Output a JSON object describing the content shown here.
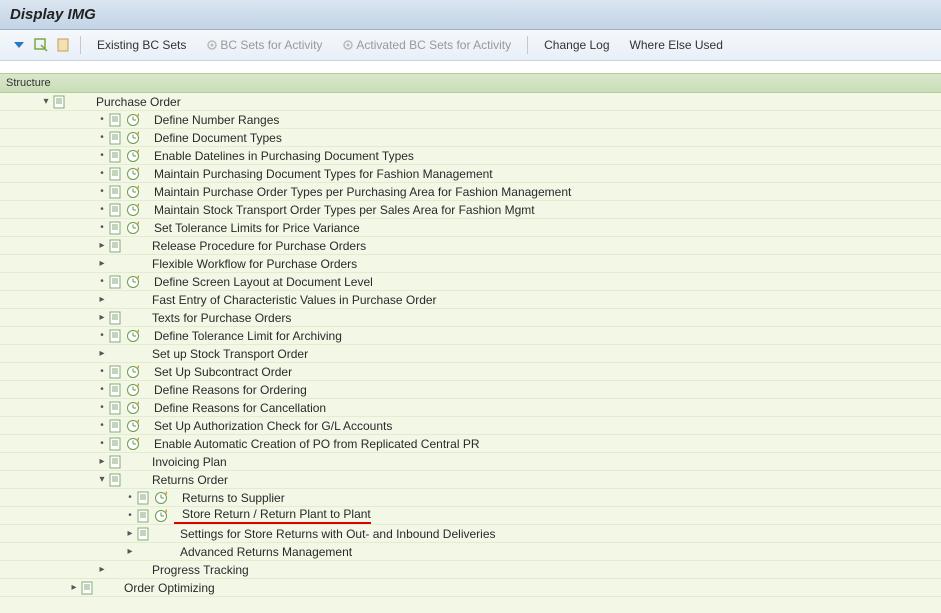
{
  "header": {
    "title": "Display IMG"
  },
  "toolbar": {
    "existing_bc": "Existing BC Sets",
    "bc_activity": "BC Sets for Activity",
    "activated_bc": "Activated BC Sets for Activity",
    "change_log": "Change Log",
    "where_else": "Where Else Used"
  },
  "structure_label": "Structure",
  "tree": {
    "root": "Purchase Order",
    "nodes": [
      {
        "indent": 2,
        "toggle": "leaf",
        "doc": true,
        "clock": true,
        "label": "Define Number Ranges"
      },
      {
        "indent": 2,
        "toggle": "leaf",
        "doc": true,
        "clock": true,
        "label": "Define Document Types"
      },
      {
        "indent": 2,
        "toggle": "leaf",
        "doc": true,
        "clock": true,
        "label": "Enable Datelines in Purchasing Document Types"
      },
      {
        "indent": 2,
        "toggle": "leaf",
        "doc": true,
        "clock": true,
        "label": "Maintain Purchasing Document Types for Fashion Management"
      },
      {
        "indent": 2,
        "toggle": "leaf",
        "doc": true,
        "clock": true,
        "label": "Maintain Purchase Order Types per Purchasing Area for Fashion Management"
      },
      {
        "indent": 2,
        "toggle": "leaf",
        "doc": true,
        "clock": true,
        "label": "Maintain Stock Transport Order Types per Sales Area for Fashion Mgmt"
      },
      {
        "indent": 2,
        "toggle": "leaf",
        "doc": true,
        "clock": true,
        "label": "Set Tolerance Limits for Price Variance"
      },
      {
        "indent": 2,
        "toggle": "closed",
        "doc": true,
        "clock": false,
        "label": "Release Procedure for Purchase Orders"
      },
      {
        "indent": 2,
        "toggle": "closed",
        "doc": false,
        "clock": false,
        "label": "Flexible Workflow for Purchase Orders",
        "noIcons": true
      },
      {
        "indent": 2,
        "toggle": "leaf",
        "doc": true,
        "clock": true,
        "label": "Define Screen Layout at Document Level"
      },
      {
        "indent": 2,
        "toggle": "closed",
        "doc": false,
        "clock": false,
        "label": "Fast Entry of Characteristic Values in Purchase Order",
        "noIcons": true
      },
      {
        "indent": 2,
        "toggle": "closed",
        "doc": true,
        "clock": false,
        "label": "Texts for Purchase Orders"
      },
      {
        "indent": 2,
        "toggle": "leaf",
        "doc": true,
        "clock": true,
        "label": "Define Tolerance Limit for Archiving"
      },
      {
        "indent": 2,
        "toggle": "closed",
        "doc": false,
        "clock": false,
        "label": "Set up Stock Transport Order",
        "noIcons": true
      },
      {
        "indent": 2,
        "toggle": "leaf",
        "doc": true,
        "clock": true,
        "label": "Set Up Subcontract Order"
      },
      {
        "indent": 2,
        "toggle": "leaf",
        "doc": true,
        "clock": true,
        "label": "Define Reasons for Ordering"
      },
      {
        "indent": 2,
        "toggle": "leaf",
        "doc": true,
        "clock": true,
        "label": "Define Reasons for Cancellation"
      },
      {
        "indent": 2,
        "toggle": "leaf",
        "doc": true,
        "clock": true,
        "label": "Set Up Authorization Check for G/L Accounts"
      },
      {
        "indent": 2,
        "toggle": "leaf",
        "doc": true,
        "clock": true,
        "label": "Enable Automatic Creation of PO from Replicated Central PR"
      },
      {
        "indent": 2,
        "toggle": "closed",
        "doc": true,
        "clock": false,
        "label": "Invoicing Plan"
      },
      {
        "indent": 2,
        "toggle": "open",
        "doc": true,
        "clock": false,
        "label": "Returns Order"
      },
      {
        "indent": 3,
        "toggle": "leaf",
        "doc": true,
        "clock": true,
        "label": "Returns to Supplier"
      },
      {
        "indent": 3,
        "toggle": "leaf",
        "doc": true,
        "clock": true,
        "label": "Store Return / Return Plant to Plant",
        "highlight": true
      },
      {
        "indent": 3,
        "toggle": "closed",
        "doc": true,
        "clock": false,
        "label": "Settings for Store Returns with Out- and Inbound Deliveries"
      },
      {
        "indent": 3,
        "toggle": "closed",
        "doc": false,
        "clock": false,
        "label": "Advanced Returns Management",
        "noIcons": true
      },
      {
        "indent": 2,
        "toggle": "closed",
        "doc": false,
        "clock": false,
        "label": "Progress Tracking",
        "noIcons": true
      },
      {
        "indent": 1,
        "toggle": "closed",
        "doc": true,
        "clock": false,
        "label": "Order Optimizing"
      }
    ]
  }
}
